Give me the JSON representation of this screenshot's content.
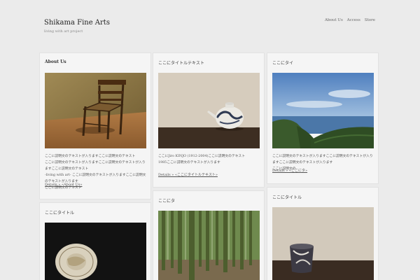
{
  "site": {
    "title": "Shikama Fine Arts",
    "tagline": "living with art project"
  },
  "nav": [
    "About Us",
    "Access",
    "Store"
  ],
  "cards": {
    "about": {
      "title": "About Us",
      "text1": "ここに説明文のテキストが入りますここに説明文のテキスト",
      "text2": "ここに説明文のテキストが入りますここに説明文のテキストが入りますここに説明文のテキスト",
      "text3": "-living with art- ここに説明文のテキストが入りますここに説明文のテキストが入ります",
      "text4": "ここに説明文のテキスト",
      "details": "Details » «About Us»"
    },
    "pottery": {
      "title": "ここにタイトルテキスト",
      "text1": "ここにJiro KINJO (1912-2004)ここに説明文のテキスト",
      "text2": "1985ここに説明文のテキストが入ります",
      "details": "Details » «ここにタイトルテキスト»"
    },
    "coast": {
      "title": "ここにタイ",
      "text1": "ここに説明文のテキストが入りますここに説明文のテキストが入りますここに説明文のテキストが入ります",
      "text2": "ここに説明文の",
      "details": "Details » «ここにタ»"
    },
    "plate": {
      "title": "ここにタイトル"
    },
    "bamboo": {
      "title": "ここにタ"
    },
    "cup": {
      "title": "ここにタイトル"
    }
  }
}
